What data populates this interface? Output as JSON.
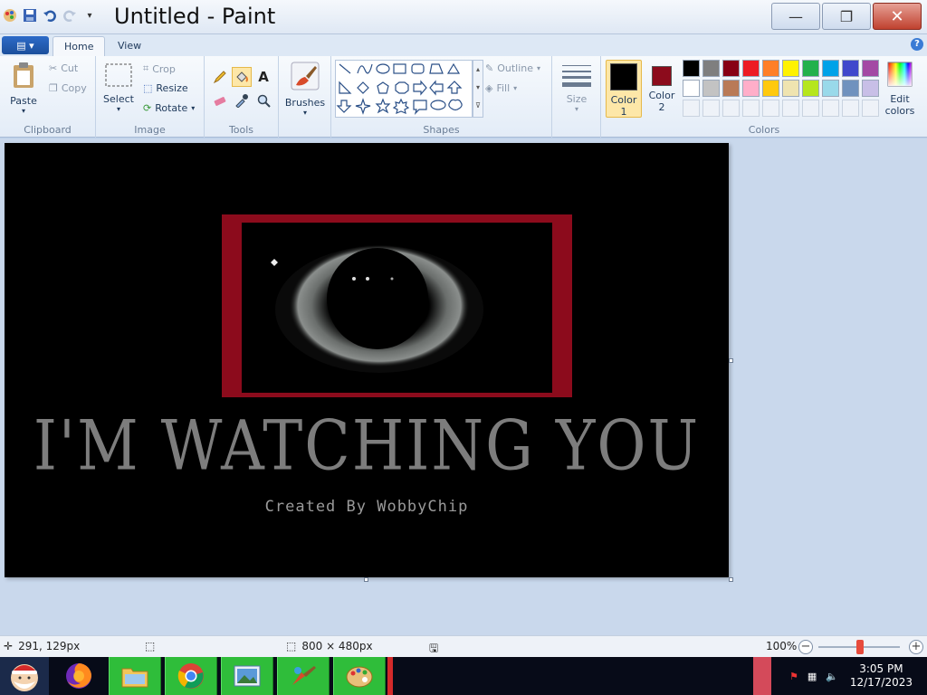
{
  "window": {
    "title": "Untitled - Paint",
    "minimize": "—",
    "maximize": "❐",
    "close": "✕"
  },
  "tabs": {
    "file": "▤ ▾",
    "home": "Home",
    "view": "View",
    "help": "?"
  },
  "ribbon": {
    "clipboard": {
      "label": "Clipboard",
      "paste": "Paste",
      "cut": "Cut",
      "copy": "Copy"
    },
    "image": {
      "label": "Image",
      "select": "Select",
      "crop": "Crop",
      "resize": "Resize",
      "rotate": "Rotate"
    },
    "tools": {
      "label": "Tools"
    },
    "brushes": {
      "label": "Brushes"
    },
    "shapes": {
      "label": "Shapes",
      "outline": "Outline",
      "fill": "Fill"
    },
    "size": {
      "label": "Size"
    },
    "colors": {
      "label": "Colors",
      "color1": {
        "line1": "Color",
        "line2": "1",
        "value": "#000000"
      },
      "color2": {
        "line1": "Color",
        "line2": "2",
        "value": "#8c0b1c"
      },
      "edit_line1": "Edit",
      "edit_line2": "colors",
      "palette_row1": [
        "#000000",
        "#7f7f7f",
        "#880015",
        "#ed1c24",
        "#ff7f27",
        "#fff200",
        "#22b14c",
        "#00a2e8",
        "#3f48cc",
        "#a349a4"
      ],
      "palette_row2": [
        "#ffffff",
        "#c3c3c3",
        "#b97a57",
        "#ffaec9",
        "#ffc90e",
        "#efe4b0",
        "#b5e61d",
        "#99d9ea",
        "#7092be",
        "#c8bfe7"
      ]
    }
  },
  "canvas_art": {
    "headline": "I'M WATCHING YOU",
    "credit": "Created By WobbyChip"
  },
  "status": {
    "cursor_pos": "291, 129px",
    "selection_size": "",
    "image_size": "800 × 480px",
    "zoom": "100%"
  },
  "taskbar": {
    "time": "3:05 PM",
    "date": "12/17/2023"
  }
}
